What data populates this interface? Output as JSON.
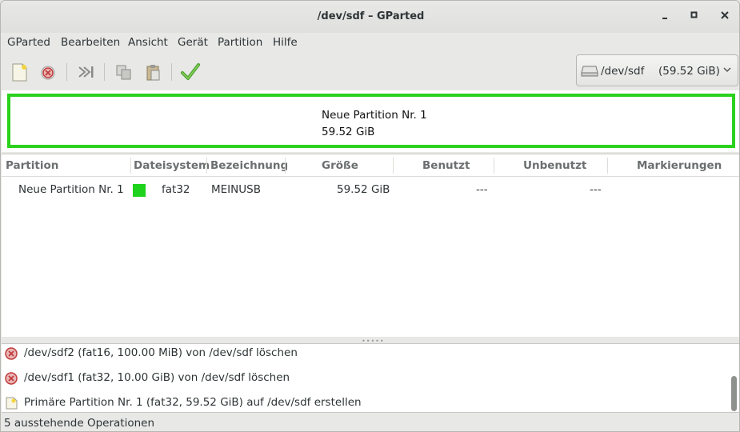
{
  "window": {
    "title": "/dev/sdf – GParted"
  },
  "menubar": [
    "GParted",
    "Bearbeiten",
    "Ansicht",
    "Gerät",
    "Partition",
    "Hilfe"
  ],
  "toolbar": {
    "icons": [
      "new-partition-icon",
      "delete-icon",
      "apply-all-icon",
      "copy-icon",
      "paste-icon",
      "apply-checkmark-icon"
    ]
  },
  "device": {
    "name": "/dev/sdf",
    "size": "(59.52 GiB)"
  },
  "diskmap": {
    "partition_name": "Neue Partition Nr. 1",
    "partition_size": "59.52 GiB",
    "color": "#2bd21d"
  },
  "table": {
    "headers": [
      "Partition",
      "Dateisystem",
      "Bezeichnung",
      "Größe",
      "Benutzt",
      "Unbenutzt",
      "Markierungen"
    ],
    "rows": [
      {
        "partition": "Neue Partition Nr. 1",
        "filesystem": "fat32",
        "label": "MEINUSB",
        "size": "59.52 GiB",
        "used": "---",
        "unused": "---",
        "flags": "",
        "fs_color": "#1ed21d"
      }
    ]
  },
  "operations": [
    {
      "icon": "delete-icon",
      "text": "/dev/sdf2 (fat16, 100.00 MiB) von /dev/sdf löschen"
    },
    {
      "icon": "delete-icon",
      "text": "/dev/sdf1 (fat32, 10.00 GiB) von /dev/sdf löschen"
    },
    {
      "icon": "new-partition-icon",
      "text": "Primäre Partition Nr. 1 (fat32, 59.52 GiB) auf /dev/sdf erstellen"
    }
  ],
  "statusbar": {
    "text": "5 ausstehende Operationen"
  }
}
